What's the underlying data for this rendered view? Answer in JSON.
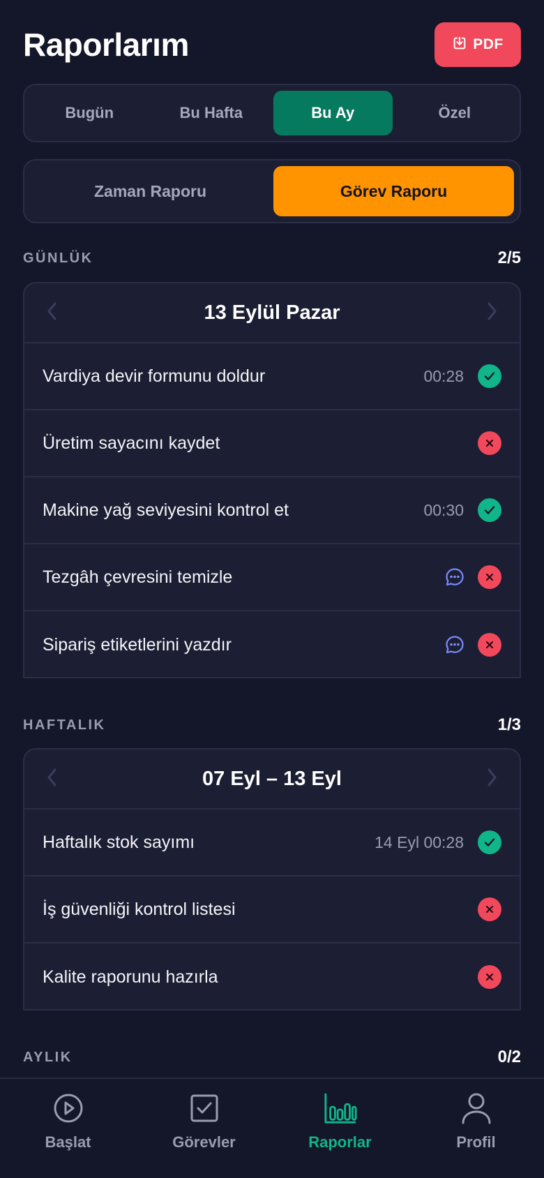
{
  "header": {
    "title": "Raporlarım",
    "pdf_label": "PDF"
  },
  "range_tabs": [
    {
      "label": "Bugün",
      "active": false
    },
    {
      "label": "Bu Hafta",
      "active": false
    },
    {
      "label": "Bu Ay",
      "active": true
    },
    {
      "label": "Özel",
      "active": false
    }
  ],
  "report_tabs": [
    {
      "label": "Zaman Raporu",
      "active": false
    },
    {
      "label": "Görev Raporu",
      "active": true
    }
  ],
  "sections": {
    "daily": {
      "title": "GÜNLÜK",
      "count": "2/5",
      "date": "13 Eylül Pazar",
      "rows": [
        {
          "label": "Vardiya devir formunu doldur",
          "time": "00:28",
          "status": "done"
        },
        {
          "label": "Üretim sayacını kaydet",
          "time": "",
          "status": "missed"
        },
        {
          "label": "Makine yağ seviyesini kontrol et",
          "time": "00:30",
          "status": "done"
        },
        {
          "label": "Tezgâh çevresini temizle",
          "time": "",
          "note": true,
          "status": "missed"
        },
        {
          "label": "Sipariş etiketlerini yazdır",
          "time": "",
          "note": true,
          "status": "missed"
        }
      ]
    },
    "weekly": {
      "title": "HAFTALIK",
      "count": "1/3",
      "date": "07 Eyl – 13 Eyl",
      "rows": [
        {
          "label": "Haftalık stok sayımı",
          "time": "14 Eyl 00:28",
          "status": "done"
        },
        {
          "label": "İş güvenliği kontrol listesi",
          "time": "",
          "status": "missed"
        },
        {
          "label": "Kalite raporunu hazırla",
          "time": "",
          "status": "missed"
        }
      ]
    },
    "monthly": {
      "title": "AYLIK",
      "count": "0/2"
    }
  },
  "bottom_nav": [
    {
      "label": "Başlat",
      "icon": "play-circle-icon",
      "active": false
    },
    {
      "label": "Görevler",
      "icon": "checkbox-icon",
      "active": false
    },
    {
      "label": "Raporlar",
      "icon": "bar-chart-icon",
      "active": true
    },
    {
      "label": "Profil",
      "icon": "user-icon",
      "active": false
    }
  ],
  "colors": {
    "background": "#141629",
    "card": "#1c1e33",
    "accent_green": "#067a5e",
    "accent_orange": "#ff9400",
    "success": "#10b58a",
    "danger": "#f2485b",
    "note": "#7b8cff"
  }
}
